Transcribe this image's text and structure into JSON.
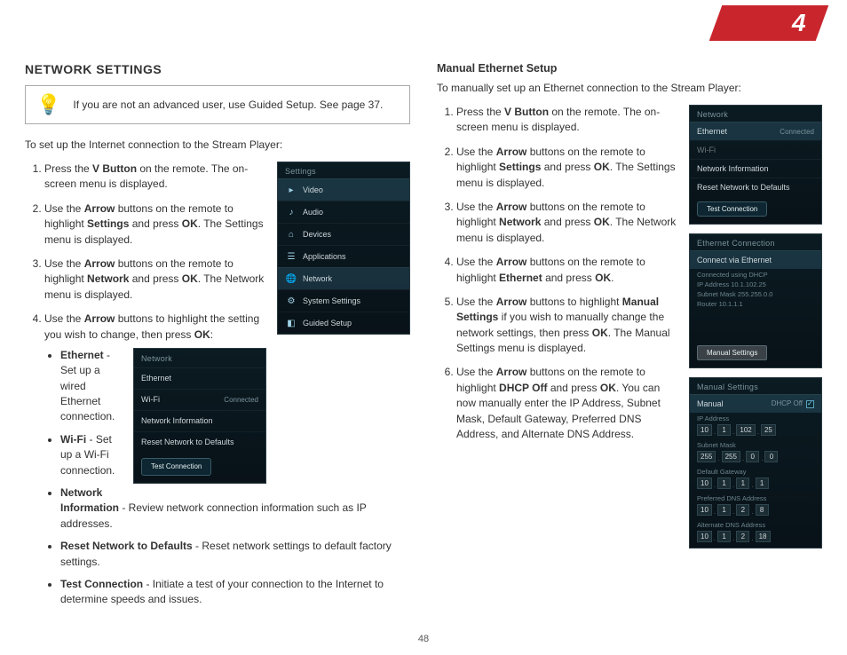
{
  "chapter_number": "4",
  "page_number": "48",
  "left": {
    "heading": "NETWORK SETTINGS",
    "tip": "If you are not an advanced user, use Guided Setup. See page 37.",
    "intro": "To set up the Internet connection to the Stream Player:",
    "steps": {
      "s1a": "Press the ",
      "s1b": "V Button",
      "s1c": " on the remote. The on-screen menu is displayed.",
      "s2a": "Use the ",
      "s2b": "Arrow",
      "s2c": " buttons on the remote to highlight ",
      "s2d": "Settings",
      "s2e": " and press ",
      "s2f": "OK",
      "s2g": ". The Settings menu is displayed.",
      "s3a": "Use the ",
      "s3b": "Arrow",
      "s3c": " buttons on the remote to highlight ",
      "s3d": "Network",
      "s3e": " and press ",
      "s3f": "OK",
      "s3g": ". The Network menu is displayed.",
      "s4a": "Use the ",
      "s4b": "Arrow",
      "s4c": " buttons to highlight the setting you wish to change, then press ",
      "s4d": "OK",
      "s4e": ":"
    },
    "bullets": {
      "b1t": "Ethernet",
      "b1d": " - Set up a wired Ethernet connection.",
      "b2t": "Wi-Fi",
      "b2d": " - Set up a Wi-Fi connection.",
      "b3t": "Network Information",
      "b3d": " - Review network connection information such as IP addresses.",
      "b4t": "Reset Network to Defaults",
      "b4d": " - Reset network settings to default factory settings.",
      "b5t": "Test Connection",
      "b5d": " - Initiate a test of your connection to the Internet to determine speeds and issues."
    },
    "shot1": {
      "title": "Settings",
      "r1": "Video",
      "r2": "Audio",
      "r3": "Devices",
      "r4": "Applications",
      "r5": "Network",
      "r6": "System Settings",
      "r7": "Guided Setup"
    },
    "shot2": {
      "title": "Network",
      "r1": "Ethernet",
      "r2l": "Wi-Fi",
      "r2r": "Connected",
      "r3": "Network Information",
      "r4": "Reset Network to Defaults",
      "btn": "Test Connection"
    }
  },
  "right": {
    "subheading": "Manual Ethernet Setup",
    "intro": "To manually set up an Ethernet connection to the Stream Player:",
    "steps": {
      "s1a": "Press the ",
      "s1b": "V Button",
      "s1c": " on the remote. The on-screen menu is displayed.",
      "s2a": "Use the ",
      "s2b": "Arrow",
      "s2c": " buttons on the remote to highlight ",
      "s2d": "Settings",
      "s2e": " and press ",
      "s2f": "OK",
      "s2g": ". The Settings menu is displayed.",
      "s3a": "Use the ",
      "s3b": "Arrow",
      "s3c": " buttons on the remote to highlight ",
      "s3d": "Network",
      "s3e": " and press ",
      "s3f": "OK",
      "s3g": ". The Network menu is displayed.",
      "s4a": "Use the ",
      "s4b": "Arrow",
      "s4c": " buttons on the remote to highlight ",
      "s4d": "Ethernet",
      "s4e": " and press ",
      "s4f": "OK",
      "s4g": ".",
      "s5a": "Use the ",
      "s5b": "Arrow",
      "s5c": " buttons to highlight ",
      "s5d": "Manual Settings",
      "s5e": " if you wish to manually change the network settings, then press ",
      "s5f": "OK",
      "s5g": ". The Manual Settings menu is displayed.",
      "s6a": "Use the ",
      "s6b": "Arrow",
      "s6c": " buttons on the remote to highlight ",
      "s6d": "DHCP Off",
      "s6e": " and press ",
      "s6f": "OK",
      "s6g": ". You can now manually enter the IP Address, Subnet Mask, Default Gateway, Preferred DNS Address, and Alternate DNS Address."
    },
    "shot1": {
      "title": "Network",
      "r1l": "Ethernet",
      "r1r": "Connected",
      "r2": "Wi-Fi",
      "r3": "Network Information",
      "r4": "Reset Network to Defaults",
      "btn": "Test Connection"
    },
    "shot2": {
      "title": "Ethernet Connection",
      "sub": "Connect via Ethernet",
      "l1": "Connected using DHCP",
      "l2": "IP Address 10.1.102.25",
      "l3": "Subnet Mask 255.255.0.0",
      "l4": "Router 10.1.1.1",
      "btn": "Manual Settings"
    },
    "shot3": {
      "title": "Manual Settings",
      "rowlabel": "Manual",
      "rowright": "DHCP Off",
      "ip_lbl": "IP Address",
      "ip": [
        "10",
        "1",
        "102",
        "25"
      ],
      "sm_lbl": "Subnet Mask",
      "sm": [
        "255",
        "255",
        "0",
        "0"
      ],
      "gw_lbl": "Default Gateway",
      "gw": [
        "10",
        "1",
        "1",
        "1"
      ],
      "p_lbl": "Preferred DNS Address",
      "p": [
        "10",
        "1",
        "2",
        "8"
      ],
      "a_lbl": "Alternate DNS Address",
      "a": [
        "10",
        "1",
        "2",
        "18"
      ]
    }
  }
}
